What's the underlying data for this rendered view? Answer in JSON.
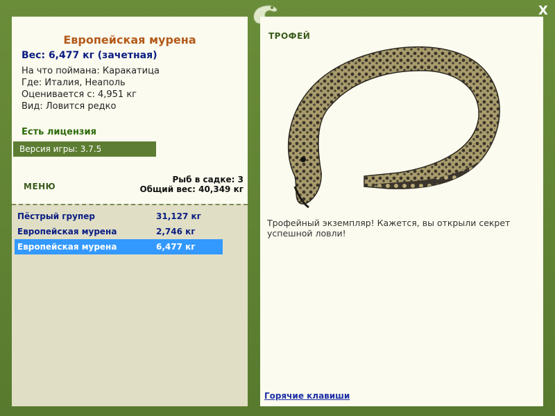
{
  "window": {
    "close_label": "X"
  },
  "fish": {
    "title": "Европейская мурена",
    "weight_line": "Вес: 6,477 кг (зачетная)",
    "caught_with": "На что поймана: Каракатица",
    "location": "Где: Италия, Неаполь",
    "rated_from": "Оценивается с: 4,951 кг",
    "kind": "Вид: Ловится редко"
  },
  "license": "Есть лицензия",
  "version": "Версия игры: 3.7.5",
  "menu_label": "МЕНЮ",
  "cage": {
    "count_line": "Рыб в садке: 3",
    "total_line": "Общий вес: 40,349 кг",
    "rows": [
      {
        "name": "Пёстрый групер",
        "weight": "31,127 кг"
      },
      {
        "name": "Европейская мурена",
        "weight": "2,746 кг"
      },
      {
        "name": "Европейская мурена",
        "weight": "6,477 кг"
      }
    ]
  },
  "trophy": {
    "label": "ТРОФЕЙ",
    "description": "Трофейный экземпляр! Кажется, вы открыли секрет успешной ловли!",
    "hotkeys": "Горячие клавиши"
  },
  "colors": {
    "frame": "#5f8134",
    "panel": "#fbfbef",
    "selection": "#3399ff",
    "title": "#b45a1a"
  }
}
